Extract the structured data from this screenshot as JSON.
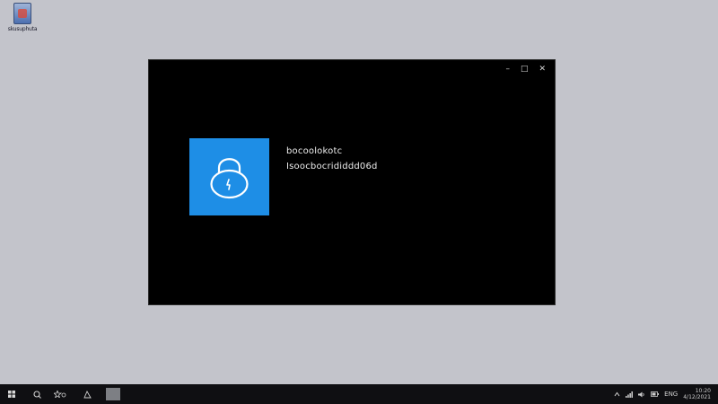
{
  "desktop": {
    "background": "#c3c4cb",
    "icons": [
      {
        "label": "skusuphuta",
        "icon": "recycle-bin-icon"
      }
    ]
  },
  "window": {
    "controls": {
      "minimize": "–",
      "maximize": "□",
      "close": "✕"
    },
    "tile_color": "#1e8ee6",
    "tile_icon": "lock-icon",
    "message_title": "bocoolokotc",
    "message_subtitle": "Isoocbocrididdd06d"
  },
  "taskbar": {
    "start_icon": "windows-start-icon",
    "search_icon": "search-icon",
    "task_view_icon": "task-view-icon",
    "widgets_icon": "widgets-icon",
    "tray": {
      "icons": [
        "chevron-up-icon",
        "network-icon",
        "volume-icon",
        "battery-icon"
      ],
      "lang": "ENG",
      "time": "10:20",
      "date": "4/12/2021"
    }
  }
}
